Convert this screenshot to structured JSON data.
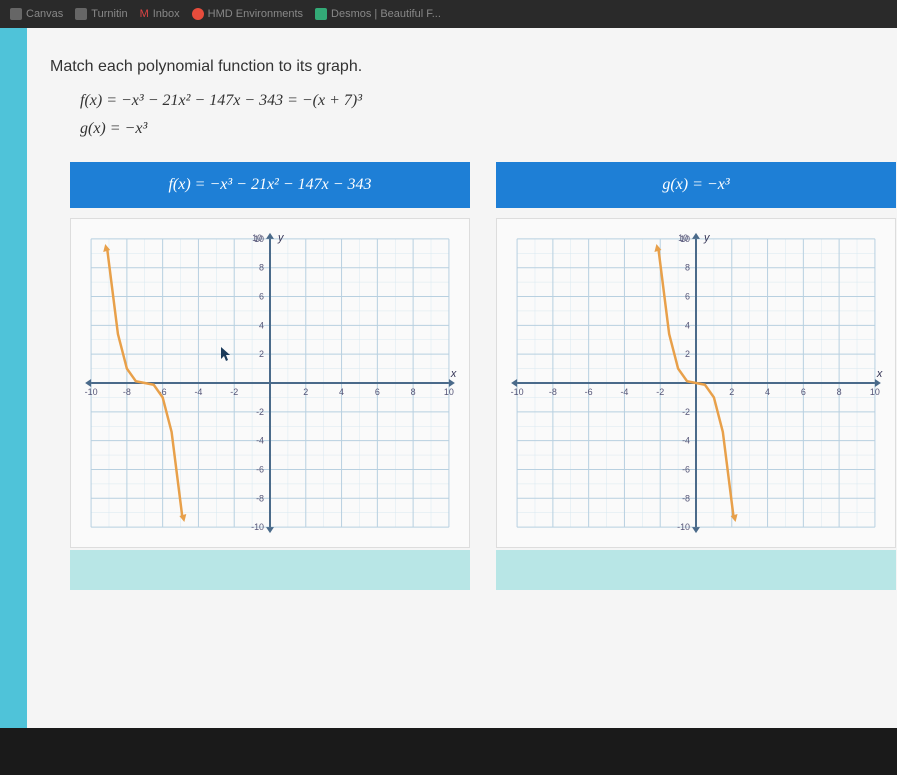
{
  "browser": {
    "tabs": [
      {
        "label": "Canvas",
        "icon": "gray"
      },
      {
        "label": "Turnitin",
        "icon": "gray"
      },
      {
        "label": "Inbox",
        "icon": "gray"
      },
      {
        "label": "HMD Environments",
        "icon": "red"
      },
      {
        "label": "Desmos | Beautiful F...",
        "icon": "gray"
      }
    ]
  },
  "question": {
    "title": "Match each polynomial function to its graph.",
    "equations": {
      "f": "f(x) = −x³ − 21x² − 147x − 343 = −(x + 7)³",
      "g": "g(x) = −x³"
    }
  },
  "cards": [
    {
      "header": "f(x) = −x³ − 21x² − 147x − 343"
    },
    {
      "header": "g(x) = −x³"
    }
  ],
  "chart_data": [
    {
      "type": "line",
      "title": "",
      "xlabel": "x",
      "ylabel": "y",
      "xlim": [
        -10,
        10
      ],
      "ylim": [
        -10,
        10
      ],
      "xticks": [
        -10,
        -8,
        -6,
        -4,
        -2,
        0,
        2,
        4,
        6,
        8,
        10
      ],
      "yticks": [
        -10,
        -8,
        -6,
        -4,
        -2,
        0,
        2,
        4,
        6,
        8,
        10
      ],
      "series": [
        {
          "name": "f(x) = -(x+7)^3",
          "color": "#e8a04a",
          "x": [
            -9.1,
            -8.5,
            -8,
            -7.5,
            -7,
            -6.5,
            -6,
            -5.5,
            -4.9
          ],
          "y": [
            9.3,
            3.4,
            1,
            0.125,
            0,
            -0.125,
            -1,
            -3.4,
            -9.3
          ]
        }
      ]
    },
    {
      "type": "line",
      "title": "",
      "xlabel": "x",
      "ylabel": "y",
      "xlim": [
        -10,
        10
      ],
      "ylim": [
        -10,
        10
      ],
      "xticks": [
        -10,
        -8,
        -6,
        -4,
        -2,
        0,
        2,
        4,
        6,
        8,
        10
      ],
      "yticks": [
        -10,
        -8,
        -6,
        -4,
        -2,
        0,
        2,
        4,
        6,
        8,
        10
      ],
      "series": [
        {
          "name": "g(x) = -x^3",
          "color": "#e8a04a",
          "x": [
            -2.1,
            -1.5,
            -1,
            -0.5,
            0,
            0.5,
            1,
            1.5,
            2.1
          ],
          "y": [
            9.3,
            3.4,
            1,
            0.125,
            0,
            -0.125,
            -1,
            -3.4,
            -9.3
          ]
        }
      ]
    }
  ]
}
